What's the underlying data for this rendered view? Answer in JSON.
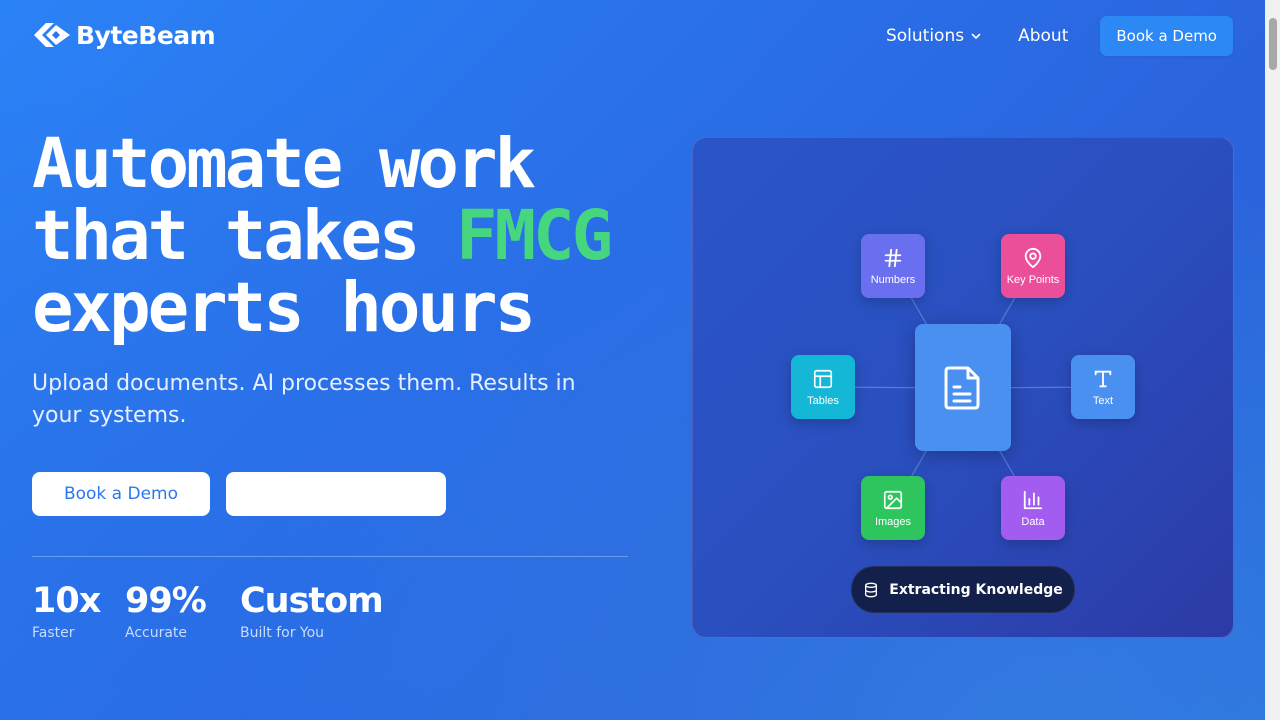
{
  "header": {
    "logo_text": "ByteBeam",
    "nav": {
      "solutions_label": "Solutions",
      "about_label": "About",
      "cta_label": "Book a Demo"
    }
  },
  "hero": {
    "headline_line1": "Automate work",
    "headline_line2_prefix": "that takes ",
    "headline_accent": "FMCG",
    "headline_line3": "experts hours",
    "subhead": "Upload documents. AI processes them. Results in your systems.",
    "primary_cta": "Book a Demo",
    "secondary_cta": ""
  },
  "stats": [
    {
      "value": "10x",
      "label": "Faster"
    },
    {
      "value": "99%",
      "label": "Accurate"
    },
    {
      "value": "Custom",
      "label": "Built for You"
    }
  ],
  "diagram": {
    "nodes": {
      "numbers": {
        "label": "Numbers",
        "icon": "hash-icon"
      },
      "key_points": {
        "label": "Key Points",
        "icon": "map-pin-icon"
      },
      "tables": {
        "label": "Tables",
        "icon": "table-icon"
      },
      "text": {
        "label": "Text",
        "icon": "text-type-icon"
      },
      "images": {
        "label": "Images",
        "icon": "image-icon"
      },
      "data": {
        "label": "Data",
        "icon": "bar-chart-icon"
      }
    },
    "center_icon": "document-icon",
    "status_text": "Extracting Knowledge",
    "status_icon": "database-icon"
  },
  "colors": {
    "accent_green": "#45d67f",
    "numbers_node": "#6a6ff0",
    "key_points_node": "#ec4f9a",
    "tables_node": "#14b8d6",
    "text_node": "#4a90f0",
    "images_node": "#2fc55e",
    "data_node": "#a35cf0"
  }
}
